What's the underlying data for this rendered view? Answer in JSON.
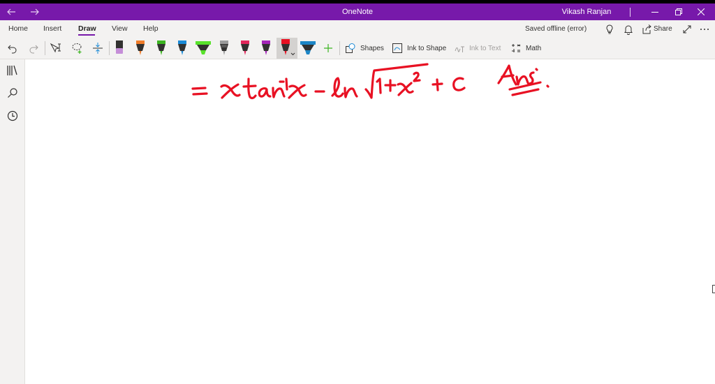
{
  "titlebar": {
    "app_title": "OneNote",
    "user_name": "Vikash Ranjan",
    "back_icon": "arrow-left-icon",
    "forward_icon": "arrow-right-icon",
    "minimize_icon": "minimize-icon",
    "restore_icon": "restore-icon",
    "close_icon": "close-icon",
    "accent_color": "#7719aa"
  },
  "menu": {
    "tabs": [
      {
        "label": "Home"
      },
      {
        "label": "Insert"
      },
      {
        "label": "Draw",
        "active": true
      },
      {
        "label": "View"
      },
      {
        "label": "Help"
      }
    ],
    "status": "Saved offline (error)",
    "share_label": "Share"
  },
  "toolbar": {
    "shapes_label": "Shapes",
    "ink_to_shape_label": "Ink to Shape",
    "ink_to_text_label": "Ink to Text",
    "math_label": "Math",
    "pens": [
      {
        "name": "pen-lavender",
        "color": "#c58ed8"
      },
      {
        "name": "pen-orange",
        "color": "#f07d2b"
      },
      {
        "name": "pen-green",
        "color": "#3cb521"
      },
      {
        "name": "pen-blue",
        "color": "#1a8ad6"
      },
      {
        "name": "highlighter-green",
        "color": "#58e22b"
      },
      {
        "name": "pen-gray",
        "color": "#9b9b9b"
      },
      {
        "name": "pen-pink",
        "color": "#e2275b"
      },
      {
        "name": "pen-purple",
        "color": "#a425b8"
      },
      {
        "name": "pen-red-selected",
        "color": "#e81123"
      },
      {
        "name": "highlighter-blue",
        "color": "#1d86c6"
      }
    ]
  },
  "ink": {
    "color": "#e81123"
  }
}
